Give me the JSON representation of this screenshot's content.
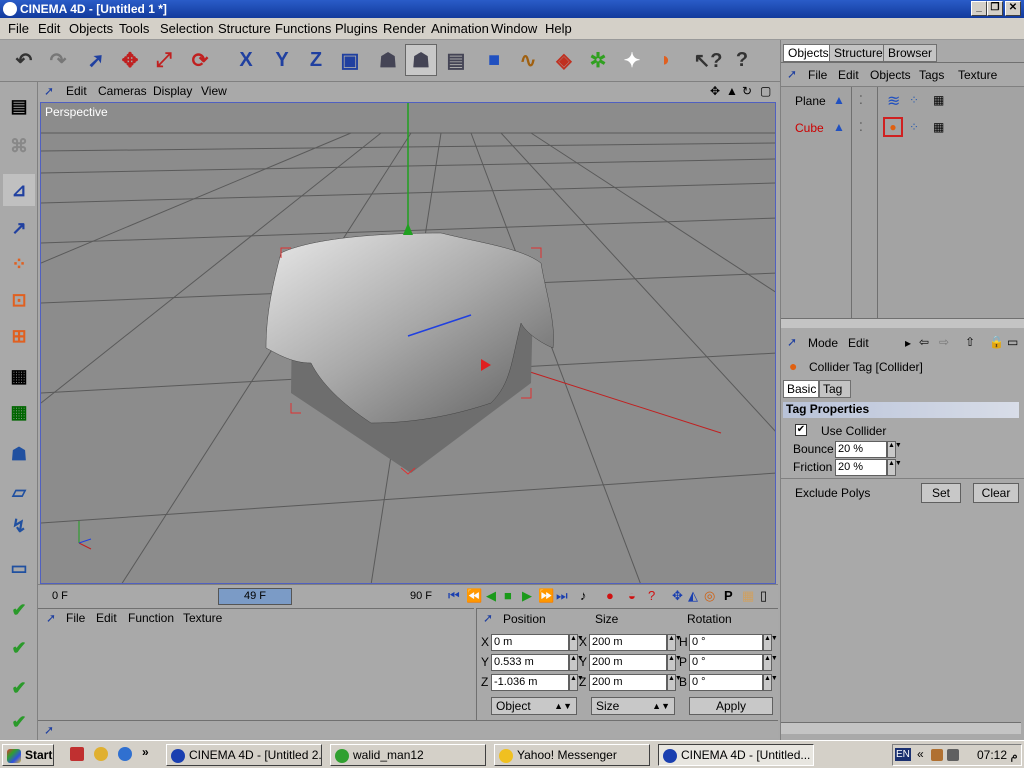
{
  "window": {
    "title": "CINEMA 4D - [Untitled 1 *]"
  },
  "menubar": [
    "File",
    "Edit",
    "Objects",
    "Tools",
    "Selection",
    "Structure",
    "Functions",
    "Plugins",
    "Render",
    "Animation",
    "Window",
    "Help"
  ],
  "viewport": {
    "menu": [
      "Edit",
      "Cameras",
      "Display",
      "View"
    ],
    "label": "Perspective"
  },
  "timeline": {
    "start": "0 F",
    "current": "49 F",
    "end": "90 F"
  },
  "bottom_menu": [
    "File",
    "Edit",
    "Function",
    "Texture"
  ],
  "coords": {
    "headers": [
      "Position",
      "Size",
      "Rotation"
    ],
    "rows": [
      {
        "pos_axis": "X",
        "pos": "0 m",
        "size_axis": "X",
        "size": "200 m",
        "rot_axis": "H",
        "rot": "0 °"
      },
      {
        "pos_axis": "Y",
        "pos": "0.533 m",
        "size_axis": "Y",
        "size": "200 m",
        "rot_axis": "P",
        "rot": "0 °"
      },
      {
        "pos_axis": "Z",
        "pos": "-1.036 m",
        "size_axis": "Z",
        "size": "200 m",
        "rot_axis": "B",
        "rot": "0 °"
      }
    ],
    "mode_select": "Object",
    "size_select": "Size",
    "apply": "Apply"
  },
  "right": {
    "tabs": [
      "Objects",
      "Structure",
      "Browser"
    ],
    "obj_menu": [
      "File",
      "Edit",
      "Objects",
      "Tags",
      "Texture"
    ],
    "objects": [
      {
        "name": "Plane",
        "color": "#000000"
      },
      {
        "name": "Cube",
        "color": "#cc0000"
      }
    ],
    "attr_menu": [
      "Mode",
      "Edit"
    ],
    "tag_title": "Collider Tag [Collider]",
    "attr_tabs": [
      "Basic",
      "Tag"
    ],
    "section": "Tag Properties",
    "use_collider": "Use Collider",
    "bounce_label": "Bounce",
    "bounce": "20 %",
    "friction_label": "Friction",
    "friction": "20 %",
    "exclude": "Exclude Polys",
    "set": "Set",
    "clear": "Clear"
  },
  "taskbar": {
    "start": "Start",
    "tasks": [
      "CINEMA 4D - [Untitled 2...",
      "walid_man12",
      "Yahoo! Messenger",
      "CINEMA 4D - [Untitled..."
    ],
    "lang": "EN",
    "time": "07:12 م"
  }
}
